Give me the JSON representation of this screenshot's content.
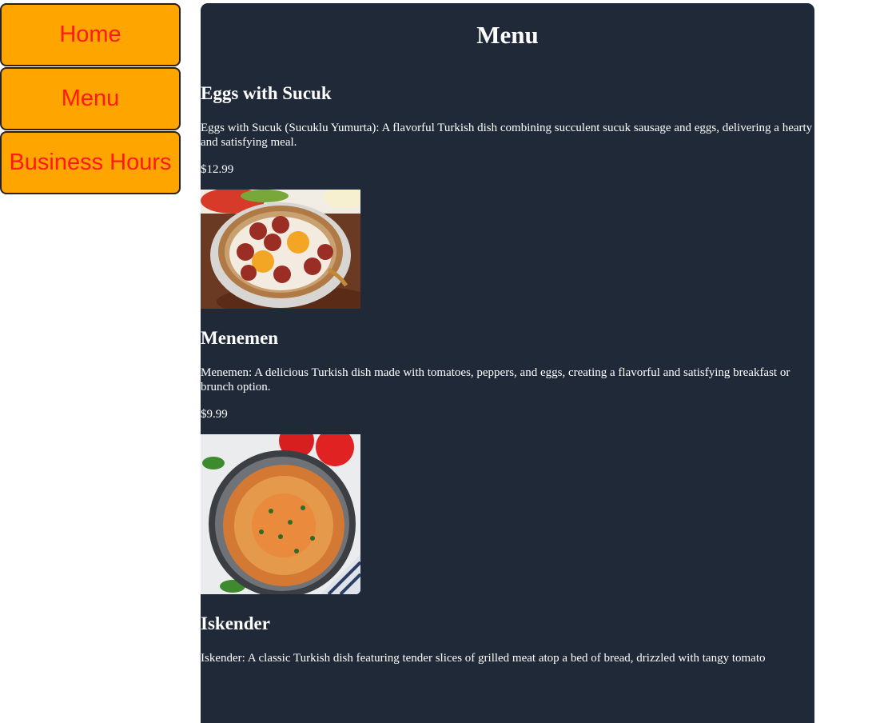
{
  "nav": {
    "items": [
      {
        "label": "Home"
      },
      {
        "label": "Menu"
      },
      {
        "label": "Business Hours"
      }
    ]
  },
  "main": {
    "title": "Menu",
    "items": [
      {
        "name": "Eggs with Sucuk",
        "description": "Eggs with Sucuk (Sucuklu Yumurta): A flavorful Turkish dish combining succulent sucuk sausage and eggs, delivering a hearty and satisfying meal.",
        "price": "$12.99"
      },
      {
        "name": "Menemen",
        "description": "Menemen: A delicious Turkish dish made with tomatoes, peppers, and eggs, creating a flavorful and satisfying breakfast or brunch option.",
        "price": "$9.99"
      },
      {
        "name": "Iskender",
        "description": "Iskender: A classic Turkish dish featuring tender slices of grilled meat atop a bed of bread, drizzled with tangy tomato"
      }
    ]
  },
  "colors": {
    "nav_background": "#ffa500",
    "nav_text": "#ff1a1a",
    "panel_background": "#1f2937"
  }
}
